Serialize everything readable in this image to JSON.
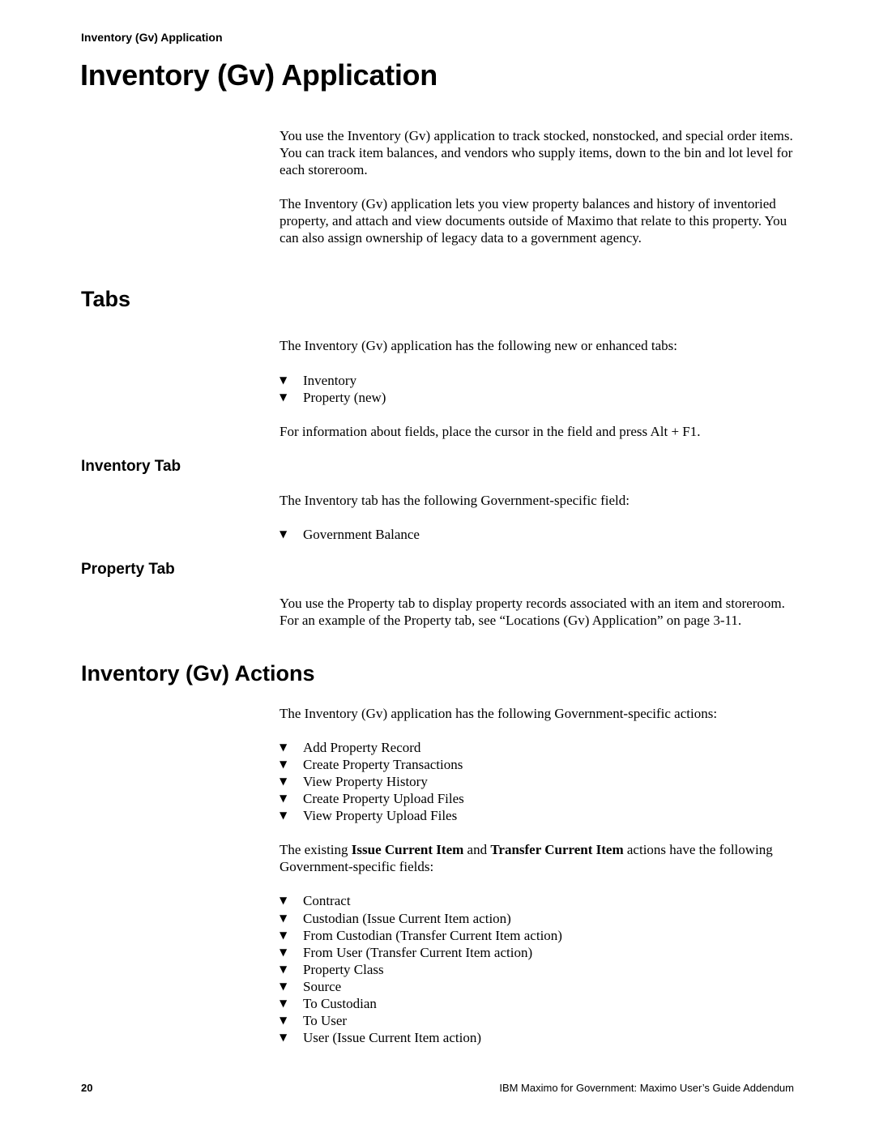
{
  "running_head": "Inventory (Gv) Application",
  "title": "Inventory (Gv) Application",
  "intro": {
    "paragraphs": [
      "You use the Inventory (Gv) application to track stocked, nonstocked, and special order items. You can track item balances, and vendors who supply items, down to the bin and lot level for each storeroom.",
      "The Inventory (Gv) application lets you view property balances and history of inventoried property, and attach and view documents outside of Maximo that relate to this property. You can also assign ownership of legacy data to a government agency."
    ]
  },
  "tabs_section": {
    "heading": "Tabs",
    "lead": "The Inventory (Gv) application has the following new or enhanced tabs:",
    "bullet_icon": "triangle-down-icon",
    "items": [
      "Inventory",
      "Property (new)"
    ],
    "note": "For information about fields, place the cursor in the field and press Alt + F1."
  },
  "inventory_tab": {
    "heading": "Inventory Tab",
    "lead": "The Inventory tab has the following Government-specific field:",
    "items": [
      "Government Balance"
    ]
  },
  "property_tab": {
    "heading": "Property Tab",
    "text": "You use the Property tab to display property records associated with an item and storeroom. For an example of the Property tab, see “Locations (Gv) Application” on page 3-11."
  },
  "actions_section": {
    "heading": "Inventory (Gv) Actions",
    "lead": "The Inventory (Gv) application has the following Government-specific actions:",
    "items": [
      "Add Property Record",
      "Create Property Transactions",
      "View Property History",
      "Create Property Upload Files",
      "View Property Upload Files"
    ],
    "existing": {
      "prefix": "The existing ",
      "bold1": "Issue Current Item",
      "mid": " and ",
      "bold2": "Transfer Current Item",
      "suffix": " actions have the following Government-specific fields:"
    },
    "fields": [
      "Contract",
      "Custodian (Issue Current Item action)",
      "From Custodian (Transfer Current Item action)",
      "From User (Transfer Current Item action)",
      "Property Class",
      "Source",
      "To Custodian",
      "To User",
      "User (Issue Current Item action)"
    ]
  },
  "bullet_glyph": "▼",
  "footer": {
    "page_number": "20",
    "book_title": "IBM Maximo for Government: Maximo User’s Guide Addendum"
  }
}
